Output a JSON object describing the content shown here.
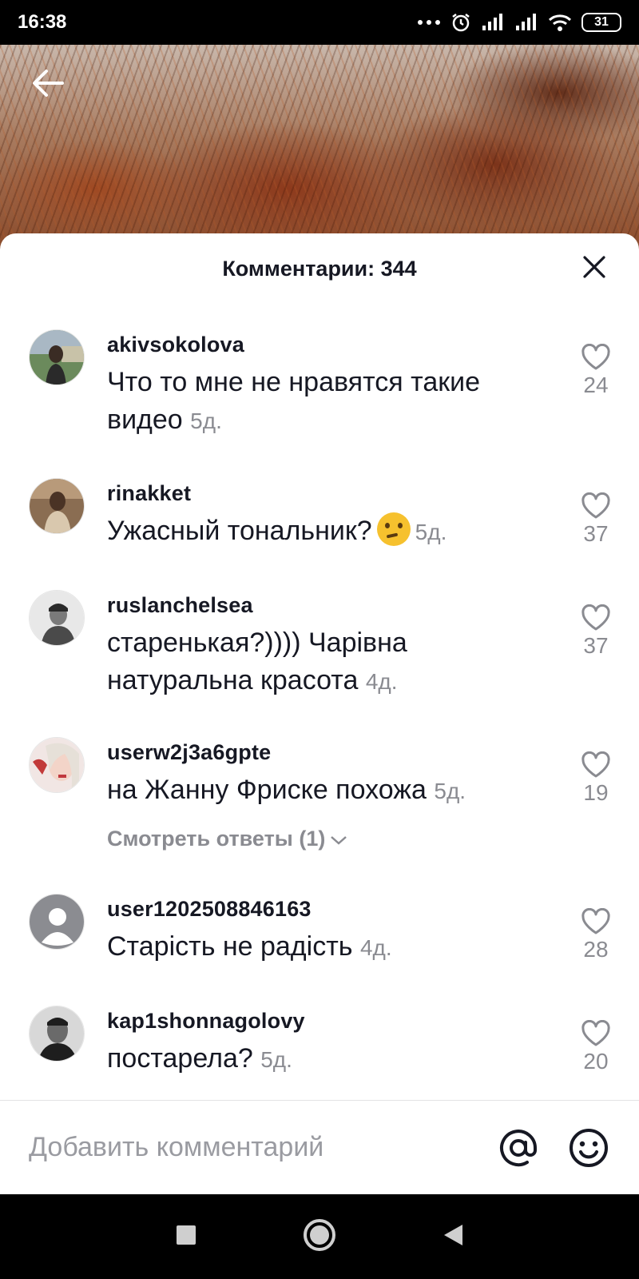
{
  "status_bar": {
    "time": "16:38",
    "battery": "31"
  },
  "sheet": {
    "title": "Комментарии: 344"
  },
  "comments": [
    {
      "username": "akivsokolova",
      "text": "Что то мне не нравятся такие видео",
      "time": "5д.",
      "likes": "24"
    },
    {
      "username": "rinakket",
      "text": "Ужасный тональник?",
      "emoji": "thinking-face",
      "time": "5д.",
      "likes": "37"
    },
    {
      "username": "ruslanchelsea",
      "text": "старенькая?)))) Чарівна натуральна красота",
      "time": "4д.",
      "likes": "37"
    },
    {
      "username": "userw2j3a6gpte",
      "text": "на Жанну Фриске похожа",
      "time": "5д.",
      "likes": "19",
      "replies_label": "Смотреть ответы (1)"
    },
    {
      "username": "user1202508846163",
      "text": "Старість не радість",
      "time": "4д.",
      "likes": "28"
    },
    {
      "username": "kap1shonnagolovy",
      "text": "постарела?",
      "time": "5д.",
      "likes": "20"
    }
  ],
  "input": {
    "placeholder": "Добавить комментарий"
  },
  "icons": {
    "back": "arrow-left-icon",
    "close": "close-icon",
    "like": "heart-outline-icon",
    "mention": "at-sign-icon",
    "emoji": "smiley-icon"
  }
}
